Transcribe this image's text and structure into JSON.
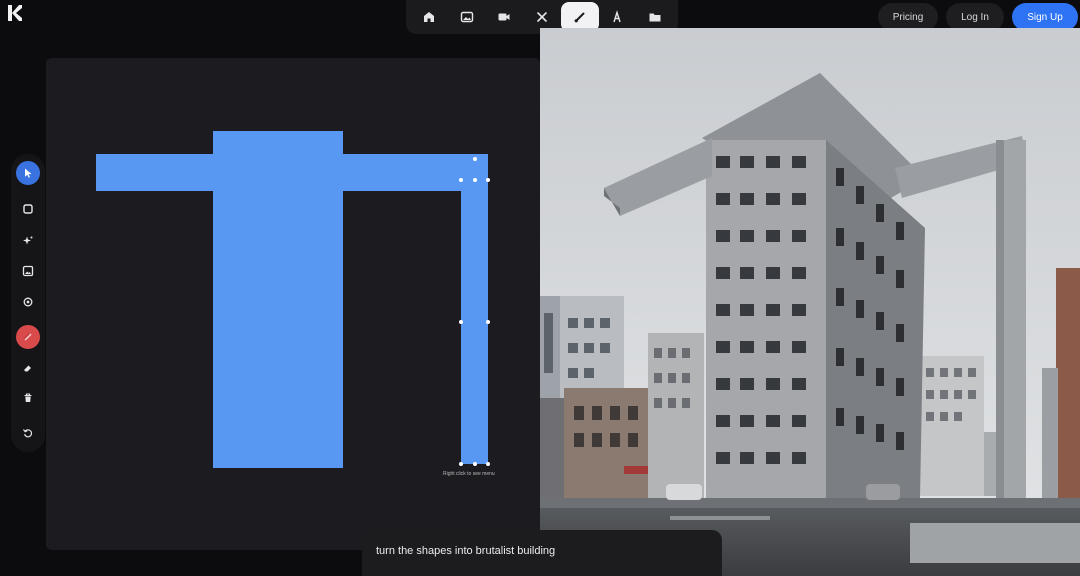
{
  "logo": {
    "icon": "k-logo-icon"
  },
  "toolbar": {
    "tools": [
      {
        "name": "home-icon"
      },
      {
        "name": "image-icon"
      },
      {
        "name": "video-icon"
      },
      {
        "name": "tools-icon"
      },
      {
        "name": "brush-icon",
        "active": true
      },
      {
        "name": "text-icon"
      },
      {
        "name": "folder-icon"
      }
    ]
  },
  "header": {
    "pricing_label": "Pricing",
    "login_label": "Log In",
    "signup_label": "Sign Up",
    "accent_color": "#2f73f5"
  },
  "left_tools": [
    "cursor-icon",
    "square-icon",
    "sparkle-icon",
    "image-icon",
    "camera-icon",
    "color-swatch-icon",
    "eraser-icon",
    "trash-icon",
    "reset-icon"
  ],
  "canvas": {
    "shape_color": "#5998f2",
    "hint": "Right click to see menu"
  },
  "prompt": {
    "text": "turn the shapes into brutalist building"
  }
}
